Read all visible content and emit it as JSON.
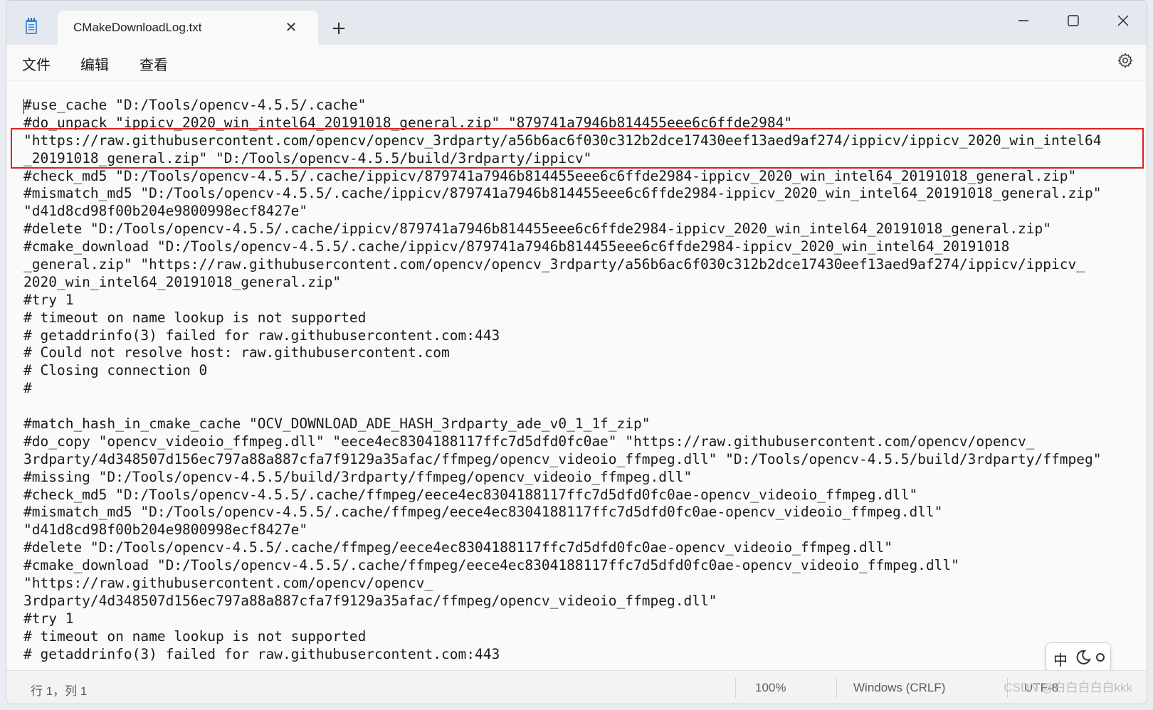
{
  "tab": {
    "title": "CMakeDownloadLog.txt",
    "close_glyph": "✕",
    "new_tab_glyph": "+"
  },
  "window_controls": {
    "minimize": "minimize-icon",
    "maximize": "maximize-icon",
    "close": "close-icon"
  },
  "menu": {
    "file": "文件",
    "edit": "编辑",
    "view": "查看"
  },
  "editor": {
    "lines": [
      "#use_cache \"D:/Tools/opencv-4.5.5/.cache\"",
      "#do_unpack \"ippicv_2020_win_intel64_20191018_general.zip\" \"879741a7946b814455eee6c6ffde2984\"",
      "\"https://raw.githubusercontent.com/opencv/opencv_3rdparty/a56b6ac6f030c312b2dce17430eef13aed9af274/ippicv/ippicv_2020_win_intel64",
      "_20191018_general.zip\" \"D:/Tools/opencv-4.5.5/build/3rdparty/ippicv\"",
      "#check_md5 \"D:/Tools/opencv-4.5.5/.cache/ippicv/879741a7946b814455eee6c6ffde2984-ippicv_2020_win_intel64_20191018_general.zip\"",
      "#mismatch_md5 \"D:/Tools/opencv-4.5.5/.cache/ippicv/879741a7946b814455eee6c6ffde2984-ippicv_2020_win_intel64_20191018_general.zip\"",
      "\"d41d8cd98f00b204e9800998ecf8427e\"",
      "#delete \"D:/Tools/opencv-4.5.5/.cache/ippicv/879741a7946b814455eee6c6ffde2984-ippicv_2020_win_intel64_20191018_general.zip\"",
      "#cmake_download \"D:/Tools/opencv-4.5.5/.cache/ippicv/879741a7946b814455eee6c6ffde2984-ippicv_2020_win_intel64_20191018",
      "_general.zip\" \"https://raw.githubusercontent.com/opencv/opencv_3rdparty/a56b6ac6f030c312b2dce17430eef13aed9af274/ippicv/ippicv_",
      "2020_win_intel64_20191018_general.zip\"",
      "#try 1",
      "# timeout on name lookup is not supported",
      "# getaddrinfo(3) failed for raw.githubusercontent.com:443",
      "# Could not resolve host: raw.githubusercontent.com",
      "# Closing connection 0",
      "#",
      "",
      "#match_hash_in_cmake_cache \"OCV_DOWNLOAD_ADE_HASH_3rdparty_ade_v0_1_1f_zip\"",
      "#do_copy \"opencv_videoio_ffmpeg.dll\" \"eece4ec8304188117ffc7d5dfd0fc0ae\" \"https://raw.githubusercontent.com/opencv/opencv_",
      "3rdparty/4d348507d156ec797a88a887cfa7f9129a35afac/ffmpeg/opencv_videoio_ffmpeg.dll\" \"D:/Tools/opencv-4.5.5/build/3rdparty/ffmpeg\"",
      "#missing \"D:/Tools/opencv-4.5.5/build/3rdparty/ffmpeg/opencv_videoio_ffmpeg.dll\"",
      "#check_md5 \"D:/Tools/opencv-4.5.5/.cache/ffmpeg/eece4ec8304188117ffc7d5dfd0fc0ae-opencv_videoio_ffmpeg.dll\"",
      "#mismatch_md5 \"D:/Tools/opencv-4.5.5/.cache/ffmpeg/eece4ec8304188117ffc7d5dfd0fc0ae-opencv_videoio_ffmpeg.dll\"",
      "\"d41d8cd98f00b204e9800998ecf8427e\"",
      "#delete \"D:/Tools/opencv-4.5.5/.cache/ffmpeg/eece4ec8304188117ffc7d5dfd0fc0ae-opencv_videoio_ffmpeg.dll\"",
      "#cmake_download \"D:/Tools/opencv-4.5.5/.cache/ffmpeg/eece4ec8304188117ffc7d5dfd0fc0ae-opencv_videoio_ffmpeg.dll\"",
      "\"https://raw.githubusercontent.com/opencv/opencv_",
      "3rdparty/4d348507d156ec797a88a887cfa7f9129a35afac/ffmpeg/opencv_videoio_ffmpeg.dll\"",
      "#try 1",
      "# timeout on name lookup is not supported",
      "# getaddrinfo(3) failed for raw.githubusercontent.com:443"
    ]
  },
  "ime": {
    "mode": "中"
  },
  "status": {
    "position": "行 1，列 1",
    "zoom": "100%",
    "line_ending": "Windows (CRLF)",
    "encoding": "UTF-8"
  },
  "watermark": "CSDN @白白白白白kkk",
  "colors": {
    "highlight": "#e0201f",
    "titlebar": "#e4e9f0"
  }
}
